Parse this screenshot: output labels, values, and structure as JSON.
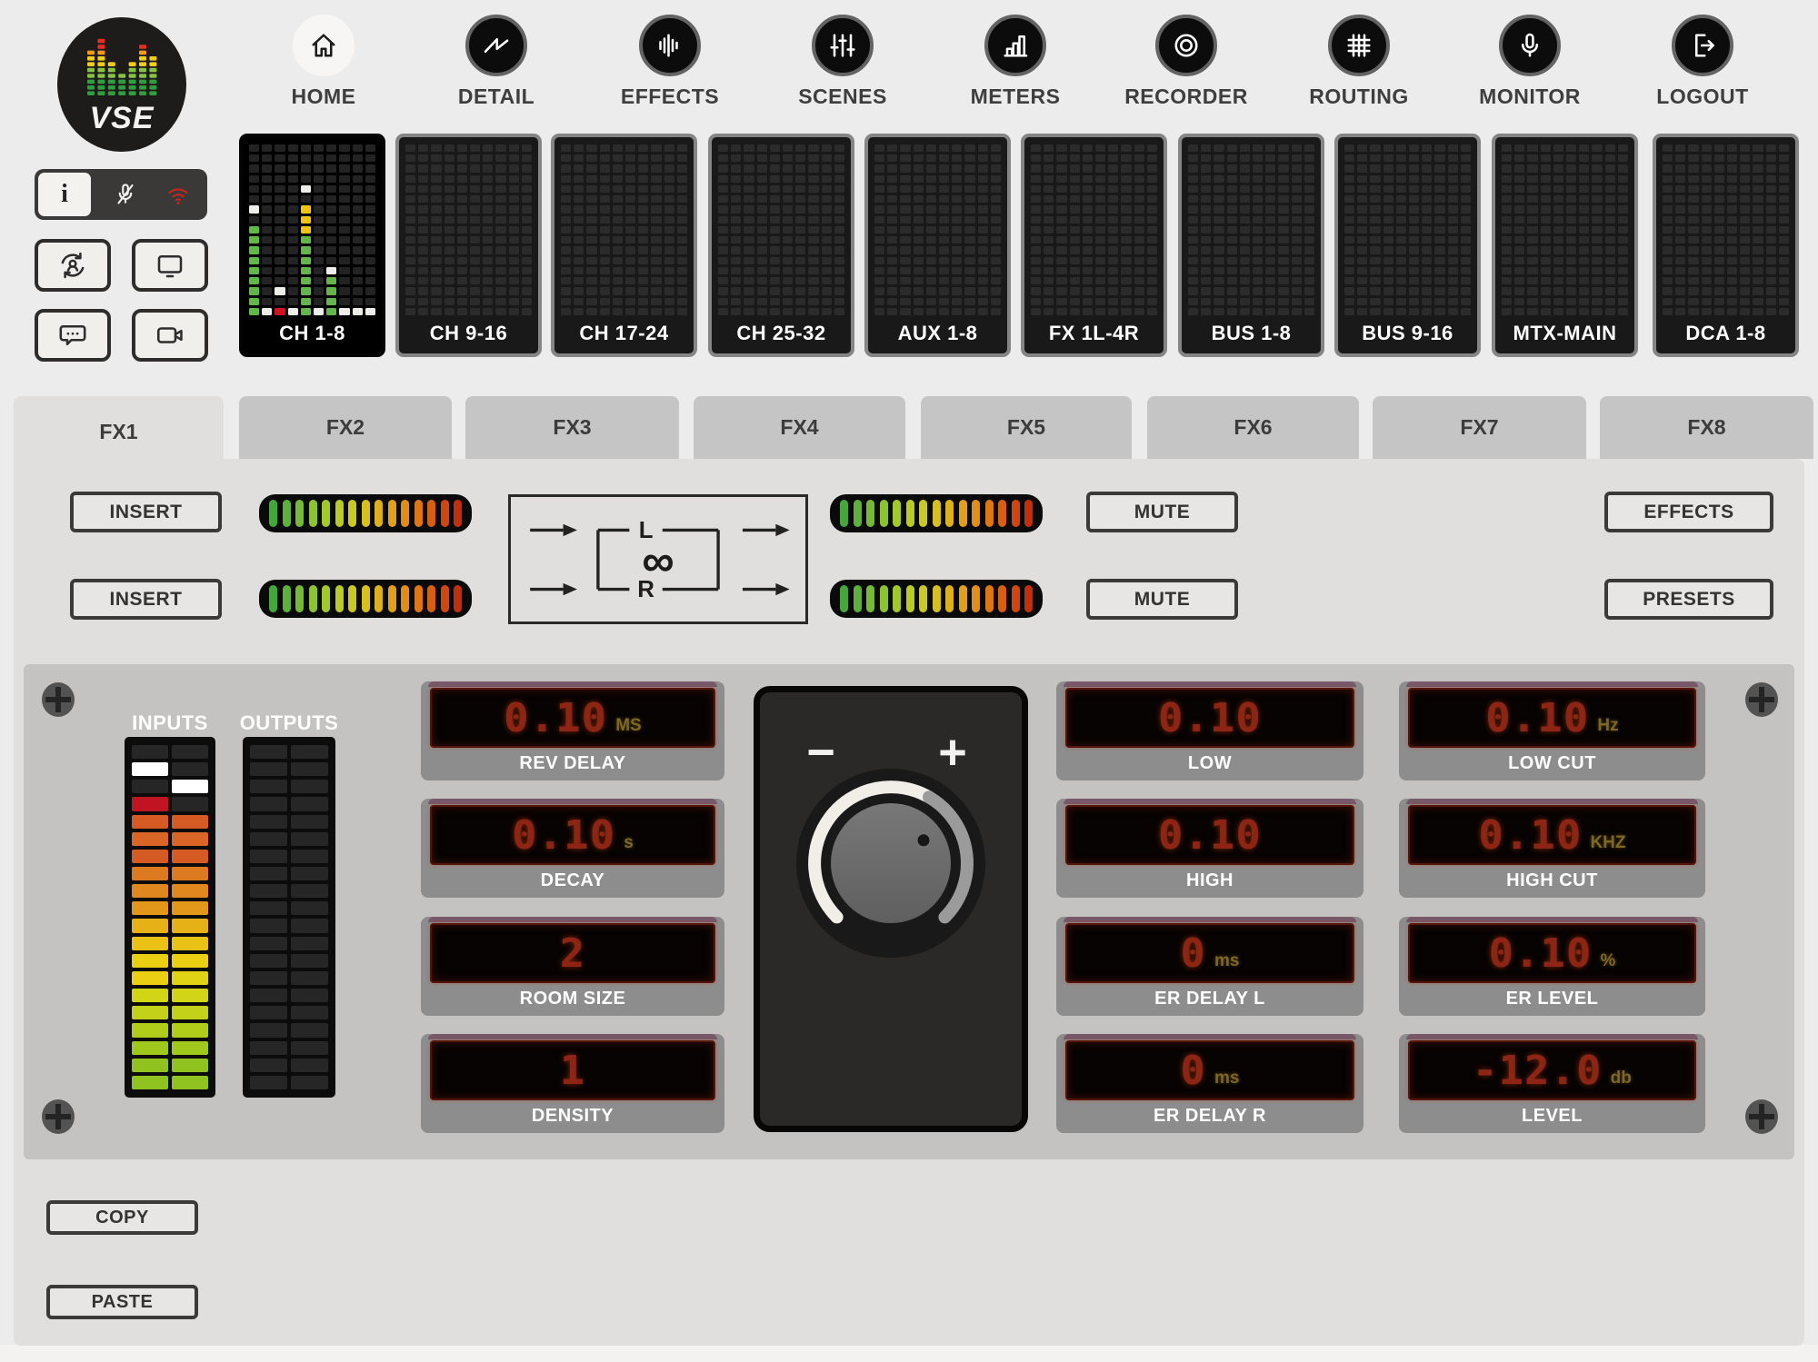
{
  "brand": {
    "logo_text": "VSE"
  },
  "nav": {
    "items": [
      {
        "label": "HOME",
        "icon": "home-icon",
        "active": true
      },
      {
        "label": "DETAIL",
        "icon": "waveform-icon",
        "active": false
      },
      {
        "label": "EFFECTS",
        "icon": "effects-bars-icon",
        "active": false
      },
      {
        "label": "SCENES",
        "icon": "faders-icon",
        "active": false
      },
      {
        "label": "METERS",
        "icon": "bar-chart-icon",
        "active": false
      },
      {
        "label": "RECORDER",
        "icon": "record-icon",
        "active": false
      },
      {
        "label": "ROUTING",
        "icon": "matrix-grid-icon",
        "active": false
      },
      {
        "label": "MONITOR",
        "icon": "microphone-icon",
        "active": false
      },
      {
        "label": "LOGOUT",
        "icon": "logout-icon",
        "active": false
      }
    ]
  },
  "quick_controls": {
    "info_label": "i",
    "bar_icons": [
      {
        "name": "mic-muted-icon",
        "color": "#f2f0ee"
      },
      {
        "name": "wifi-icon",
        "color": "#c9251f"
      }
    ],
    "buttons": [
      {
        "icon": "user-sync-icon"
      },
      {
        "icon": "screen-share-icon"
      },
      {
        "icon": "chat-icon"
      },
      {
        "icon": "video-camera-icon"
      }
    ]
  },
  "meter_banks": {
    "labels": [
      "CH 1-8",
      "CH 9-16",
      "CH 17-24",
      "CH 25-32",
      "AUX 1-8",
      "FX 1L-4R",
      "BUS 1-8",
      "BUS 9-16",
      "MTX-MAIN",
      "DCA 1-8"
    ],
    "active_index": 0,
    "rows": 17,
    "cols": 10,
    "active_pattern": [
      "..........",
      "..........",
      "..........",
      "..........",
      "....W.....",
      "..........",
      "W...Y.....",
      "....Y.....",
      "G...Y.....",
      "G...G.....",
      "G...G.....",
      "G...G.....",
      "G...G.W...",
      "G...G.G...",
      "G.W.G.G...",
      "G...G.G...",
      "GWRWGWGWWW"
    ],
    "cell_colors": {
      "G": "#62b64a",
      "Y": "#f0c411",
      "R": "#cf1420",
      "W": "#efedea",
      ".": "#232323"
    },
    "off_cell_color": "#2b2b2b"
  },
  "fx_tabs": {
    "labels": [
      "FX1",
      "FX2",
      "FX3",
      "FX4",
      "FX5",
      "FX6",
      "FX7",
      "FX8"
    ],
    "active_index": 0
  },
  "fx_section": {
    "insert_label": "INSERT",
    "mute_label": "MUTE",
    "effects_label": "EFFECTS",
    "presets_label": "PRESETS",
    "led_gradient": [
      "#45a63c",
      "#5bb13a",
      "#74ba36",
      "#8dc231",
      "#a3c82c",
      "#b8cb27",
      "#c9c922",
      "#d6c01e",
      "#ddb11b",
      "#e1a018",
      "#e18d16",
      "#dd7713",
      "#d75f11",
      "#cf470f",
      "#c52e0d"
    ],
    "routing": {
      "left_label": "L",
      "right_label": "R",
      "infinity_symbol": "∞"
    }
  },
  "main_panel": {
    "inputs_label": "INPUTS",
    "outputs_label": "OUTPUTS",
    "input_meter": [
      [
        "-",
        "-"
      ],
      [
        "W",
        "-"
      ],
      [
        "-",
        "W"
      ],
      [
        "R",
        "-"
      ],
      [
        "o1",
        "o1"
      ],
      [
        "o2",
        "o2"
      ],
      [
        "o1",
        "o1"
      ],
      [
        "o3",
        "o3"
      ],
      [
        "o4",
        "o4"
      ],
      [
        "o5",
        "o5"
      ],
      [
        "y1",
        "y1"
      ],
      [
        "y2",
        "y2"
      ],
      [
        "y3",
        "y3"
      ],
      [
        "y3",
        "y4"
      ],
      [
        "g1",
        "g1"
      ],
      [
        "g2",
        "g2"
      ],
      [
        "g3",
        "g3"
      ],
      [
        "g4",
        "g4"
      ],
      [
        "g5",
        "g5"
      ],
      [
        "g5",
        "g5"
      ]
    ],
    "output_meter_rows": 20,
    "meter_colors": {
      "-": "#262626",
      "W": "#ffffff",
      "R": "#c01423",
      "o1": "#d65a23",
      "o2": "#d96527",
      "o3": "#dd7a20",
      "o4": "#e0881d",
      "o5": "#e2961a",
      "y1": "#e6b117",
      "y2": "#eac215",
      "y3": "#ebcf12",
      "y4": "#e0d214",
      "g1": "#d2d516",
      "g2": "#c3d218",
      "g3": "#b1cd1a",
      "g4": "#a0c81d",
      "g5": "#90c31f"
    },
    "displays": {
      "col_left": [
        {
          "label": "REV DELAY",
          "value": "0.10",
          "unit": "MS"
        },
        {
          "label": "DECAY",
          "value": "0.10",
          "unit": "s"
        },
        {
          "label": "ROOM SIZE",
          "value": "2",
          "unit": ""
        },
        {
          "label": "DENSITY",
          "value": "1",
          "unit": ""
        }
      ],
      "col_mid": [
        {
          "label": "LOW",
          "value": "0.10",
          "unit": ""
        },
        {
          "label": "HIGH",
          "value": "0.10",
          "unit": ""
        },
        {
          "label": "ER DELAY L",
          "value": "0",
          "unit": "ms"
        },
        {
          "label": "ER DELAY R",
          "value": "0",
          "unit": "ms"
        }
      ],
      "col_right": [
        {
          "label": "LOW CUT",
          "value": "0.10",
          "unit": "Hz"
        },
        {
          "label": "HIGH CUT",
          "value": "0.10",
          "unit": "KHZ"
        },
        {
          "label": "ER LEVEL",
          "value": "0.10",
          "unit": "%"
        },
        {
          "label": "LEVEL",
          "value": "-12.0",
          "unit": "db"
        }
      ]
    },
    "knob": {
      "minus_label": "−",
      "plus_label": "+"
    }
  },
  "footer": {
    "copy_label": "COPY",
    "paste_label": "PASTE"
  },
  "colors": {
    "accent_red": "#c9251f",
    "lcd_digit": "#8e2413",
    "lcd_unit": "#7d6823",
    "page_bg": "#edecec",
    "fx_panel": "#e0dfde",
    "inner_panel": "#c4c3c2"
  }
}
